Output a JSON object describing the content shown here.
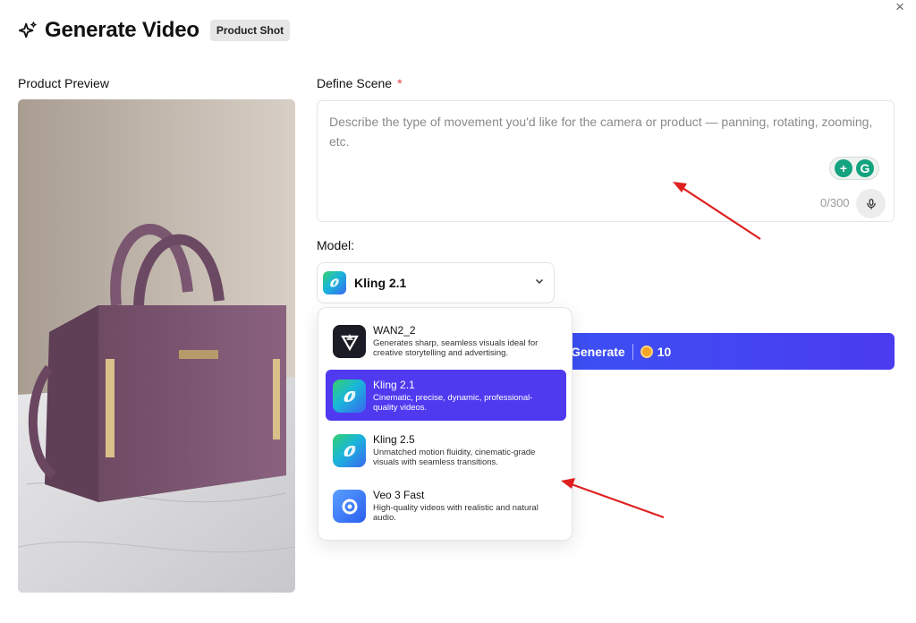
{
  "header": {
    "title": "Generate Video",
    "badge": "Product Shot",
    "close_glyph": "×"
  },
  "preview": {
    "label": "Product Preview"
  },
  "scene": {
    "label": "Define Scene",
    "required_mark": "*",
    "placeholder": "Describe the type of movement you'd like for the camera or product — panning, rotating, zooming, etc.",
    "counter": "0/300"
  },
  "model": {
    "label": "Model:",
    "selected": "Kling 2.1",
    "options": [
      {
        "name": "WAN2_2",
        "desc": "Generates sharp, seamless visuals ideal for creative storytelling and advertising.",
        "icon": "wan-logo-icon"
      },
      {
        "name": "Kling 2.1",
        "desc": "Cinematic, precise, dynamic, professional-quality videos.",
        "icon": "kling-logo-icon"
      },
      {
        "name": "Kling 2.5",
        "desc": "Unmatched motion fluidity, cinematic-grade visuals with seamless transitions.",
        "icon": "kling-logo-icon"
      },
      {
        "name": "Veo 3 Fast",
        "desc": "High-quality videos with realistic and natural audio.",
        "icon": "veo-logo-icon"
      }
    ]
  },
  "generate": {
    "label": "Generate",
    "credits": "10"
  },
  "colors": {
    "accent": "#4f3af0",
    "button": "#3b50f4",
    "required": "#e23b3b",
    "annotation_arrow": "#e02020"
  }
}
